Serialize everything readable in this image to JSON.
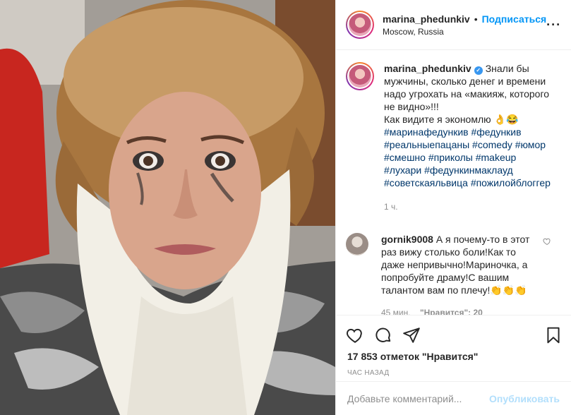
{
  "header": {
    "username": "marina_phedunkiv",
    "dot": "•",
    "follow_label": "Подписаться",
    "location": "Moscow, Russia",
    "more_label": "···"
  },
  "caption": {
    "username": "marina_phedunkiv",
    "verified_glyph": "✓",
    "text": "Знали бы мужчины, сколько денег и времени надо угрохать на «макияж, которого не видно»!!!",
    "line2": "Как видите я экономлю 👌😂",
    "hashtags": [
      "#маринафедункив",
      "#федункив",
      "#реальныепацаны",
      "#comedy",
      "#юмор",
      "#смешно",
      "#приколы",
      "#makeup",
      "#лухари",
      "#федункинмаклауд",
      "#советскаяльвица",
      "#пожилойблоггер"
    ],
    "time": "1 ч."
  },
  "comment": {
    "username": "gornik9008",
    "text": "А я почему-то в этот раз вижу столько боли!Как то даже непривычно!Мариночка, а попробуйте драму!С вашим талантом вам по плечу!👏👏👏",
    "time": "45 мин.",
    "likes": "\"Нравится\": 20"
  },
  "icons": [
    "heart-icon",
    "comment-icon",
    "share-icon",
    "bookmark-icon"
  ],
  "likes_line": "17 853 отметок \"Нравится\"",
  "time_ago": "ЧАС НАЗАД",
  "add_comment": {
    "placeholder": "Добавьте комментарий...",
    "publish_label": "Опубликовать"
  },
  "colors": {
    "accent": "#0095f6",
    "publish_disabled": "#b2dffc",
    "hashtag": "#00376b",
    "muted": "#8e8e8e"
  }
}
